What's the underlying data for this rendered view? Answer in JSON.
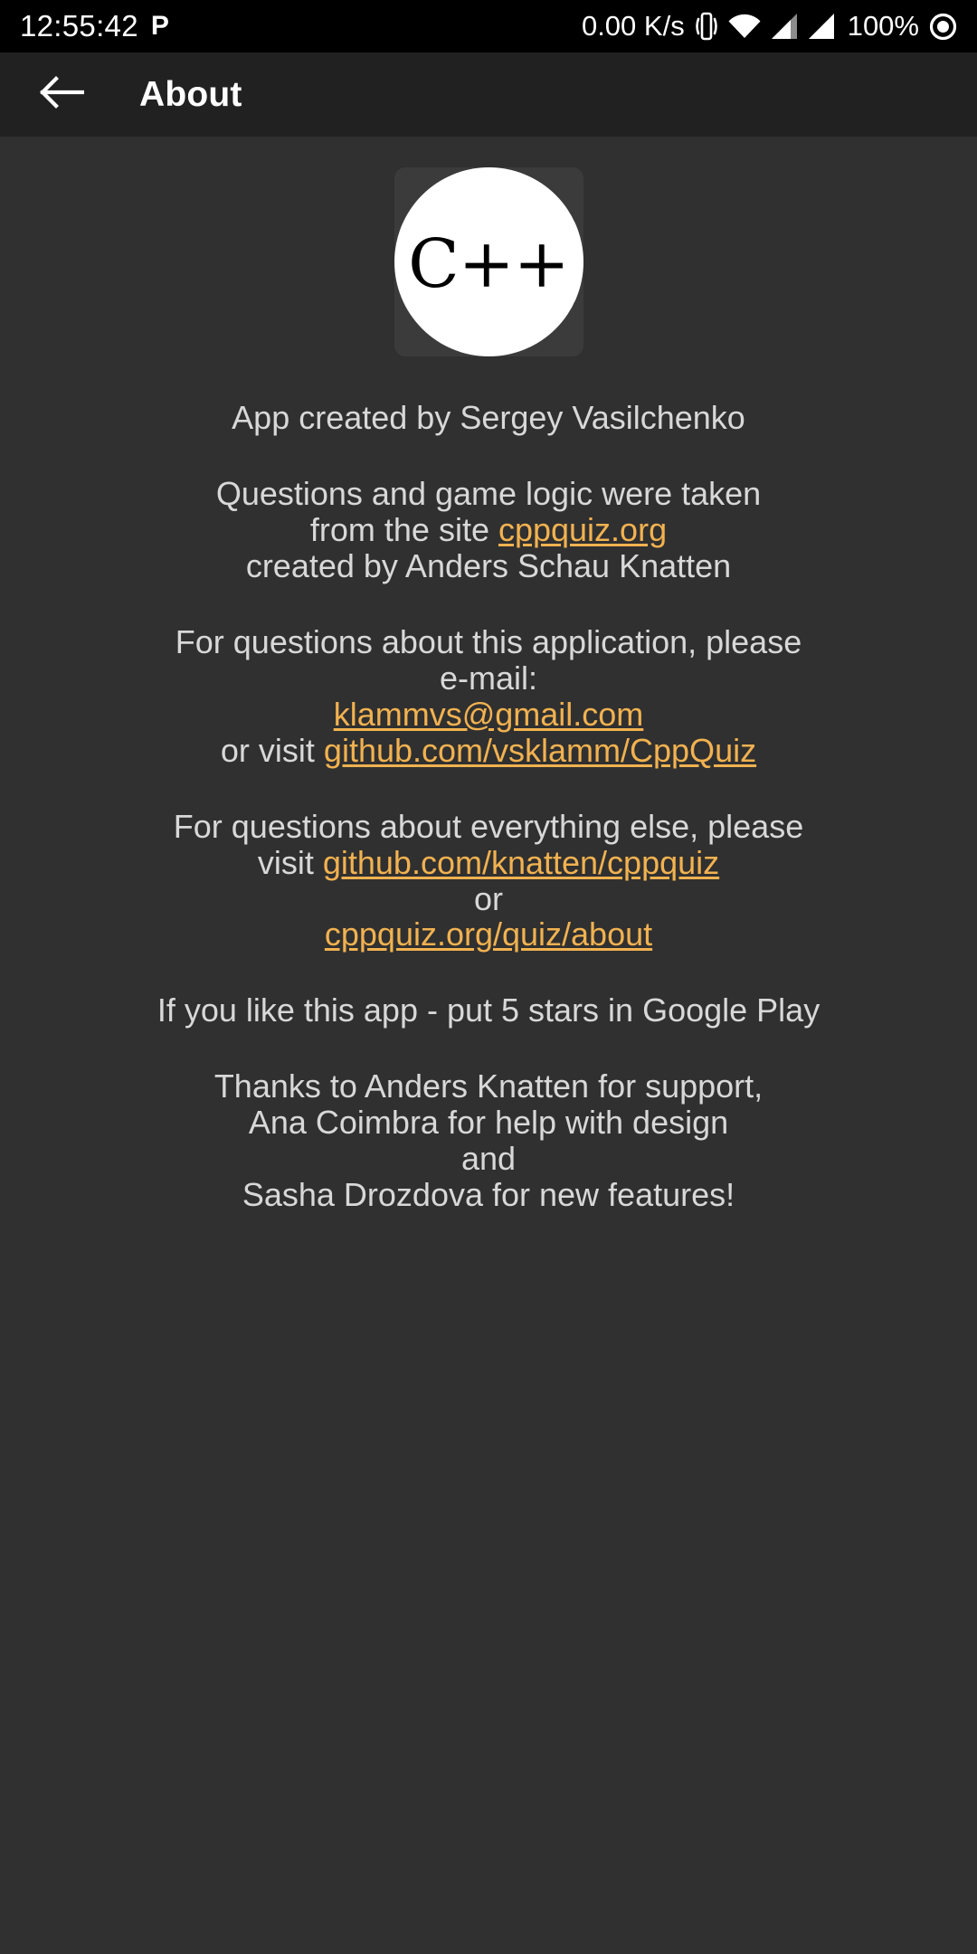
{
  "statusbar": {
    "clock": "12:55:42",
    "p_glyph": "P",
    "network_speed": "0.00 K/s",
    "battery": "100%",
    "icons": [
      "vibrate-icon",
      "wifi-icon",
      "signal-1-icon",
      "signal-2-icon",
      "battery-circle-icon"
    ]
  },
  "appbar": {
    "back_icon": "arrow-left-icon",
    "title": "About"
  },
  "logo": {
    "text": "C++",
    "alt": "cpp-quiz-logo"
  },
  "body": {
    "p1": {
      "l1": "App created by Sergey Vasilchenko"
    },
    "p2": {
      "l1": "Questions and game logic were taken",
      "l2_pre": "from the site ",
      "l2_link": "cppquiz.org",
      "l3": "created by Anders Schau Knatten"
    },
    "p3": {
      "l1": "For questions about this application, please",
      "l2": "e-mail:",
      "l3_link": "klammvs@gmail.com",
      "l4_pre": "or visit ",
      "l4_link": "github.com/vsklamm/CppQuiz"
    },
    "p4": {
      "l1": "For questions about everything else, please",
      "l2_pre": "visit ",
      "l2_link": "github.com/knatten/cppquiz",
      "l3": "or",
      "l4_link": "cppquiz.org/quiz/about"
    },
    "p5": {
      "l1": "If you like this app - put 5 stars in Google Play"
    },
    "p6": {
      "l1": "Thanks to Anders Knatten for support,",
      "l2": "Ana Coimbra for help with design",
      "l3": "and",
      "l4": "Sasha Drozdova for new features!"
    }
  },
  "colors": {
    "link": "#f2b250",
    "appbar_bg": "#212121",
    "page_bg": "#303030",
    "text": "#d8d8d8"
  }
}
